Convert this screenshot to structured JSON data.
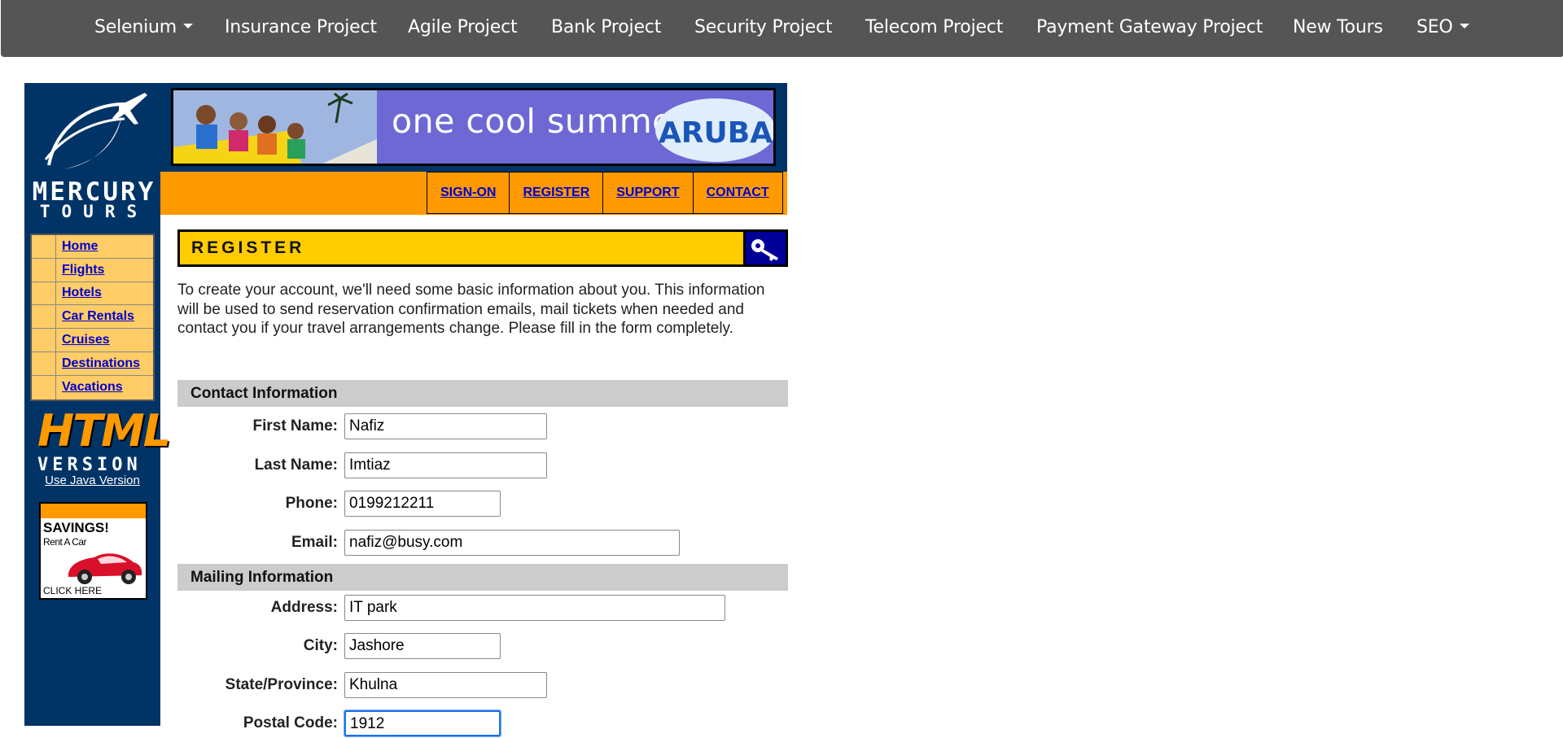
{
  "topnav": {
    "items": [
      {
        "label": "Selenium",
        "dropdown": true
      },
      {
        "label": "Insurance Project",
        "dropdown": false
      },
      {
        "label": "Agile Project",
        "dropdown": false
      },
      {
        "label": "Bank Project",
        "dropdown": false
      },
      {
        "label": "Security Project",
        "dropdown": false
      },
      {
        "label": "Telecom Project",
        "dropdown": false
      },
      {
        "label": "Payment Gateway Project",
        "dropdown": false
      },
      {
        "label": "New Tours",
        "dropdown": false
      },
      {
        "label": "SEO",
        "dropdown": true
      }
    ]
  },
  "logo": {
    "line1": "MERCURY",
    "line2": "TOURS"
  },
  "banner": {
    "text": "one cool summer",
    "badge": "ARUBA"
  },
  "toplinks": [
    "SIGN-ON",
    "REGISTER",
    "SUPPORT",
    "CONTACT"
  ],
  "sidemenu": [
    "Home",
    "Flights",
    "Hotels",
    "Car Rentals",
    "Cruises",
    "Destinations",
    "Vacations"
  ],
  "html_logo": {
    "line1": "HTML",
    "line2": "VERSION"
  },
  "java_link": "Use Java Version",
  "savings_ad": {
    "title": "SAVINGS!",
    "subtitle": "Rent A Car",
    "cta": "CLICK HERE"
  },
  "register": {
    "header": "REGISTER",
    "intro": "To create your account, we'll need some basic information about you. This information will be used to send reservation confirmation emails, mail tickets when needed and contact you if your travel arrangements change. Please fill in the form completely.",
    "contact_section": "Contact Information",
    "mailing_section": "Mailing Information",
    "fields": {
      "first_name": {
        "label": "First Name:",
        "value": "Nafiz"
      },
      "last_name": {
        "label": "Last Name:",
        "value": "Imtiaz"
      },
      "phone": {
        "label": "Phone:",
        "value": "0199212211"
      },
      "email": {
        "label": "Email:",
        "value": "nafiz@busy.com"
      },
      "address": {
        "label": "Address:",
        "value": "IT park"
      },
      "city": {
        "label": "City:",
        "value": "Jashore"
      },
      "state": {
        "label": "State/Province:",
        "value": "Khulna"
      },
      "postal": {
        "label": "Postal Code:",
        "value": "1912"
      }
    }
  },
  "colors": {
    "navbar": "#555555",
    "mercury_blue": "#003366",
    "orange": "#ff9900",
    "menu_yellow": "#ffcc66",
    "header_yellow": "#ffcc00",
    "section_gray": "#cccccc",
    "link_blue": "#0000cc",
    "focus_blue": "#1a73e8"
  }
}
